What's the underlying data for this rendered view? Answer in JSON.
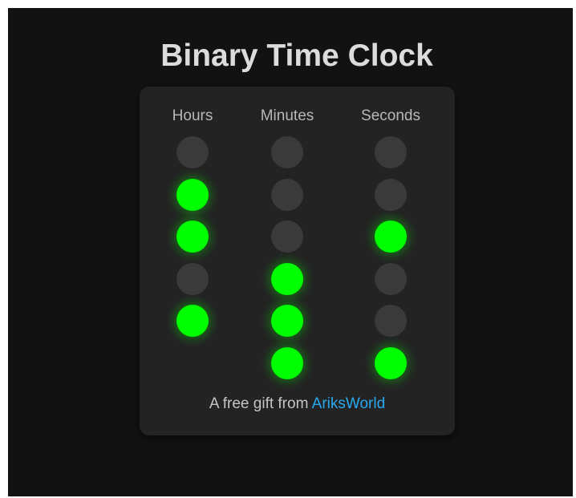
{
  "title": "Binary Time Clock",
  "colors": {
    "on": "#00ff00",
    "off": "#3a3a3a",
    "link": "#29a8f0",
    "card": "#232323",
    "background": "#121212"
  },
  "columns": [
    {
      "key": "hours",
      "label": "Hours",
      "bits": [
        0,
        1,
        1,
        0,
        1
      ]
    },
    {
      "key": "minutes",
      "label": "Minutes",
      "bits": [
        0,
        0,
        0,
        1,
        1,
        1
      ]
    },
    {
      "key": "seconds",
      "label": "Seconds",
      "bits": [
        0,
        0,
        1,
        0,
        0,
        1
      ]
    }
  ],
  "footer": {
    "text": "A free gift from",
    "link_text": "AriksWorld"
  }
}
